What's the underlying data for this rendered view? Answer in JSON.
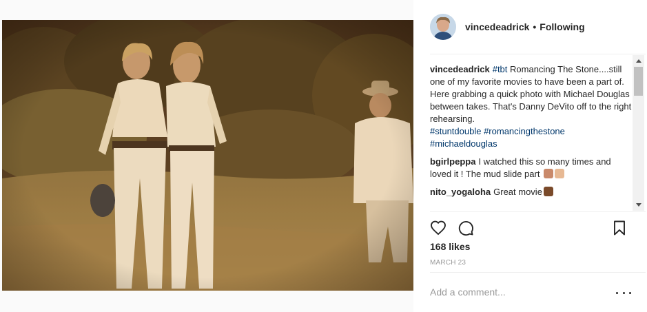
{
  "post": {
    "photo_alt": "",
    "header": {
      "username": "vincedeadrick",
      "separator": "•",
      "following_label": "Following"
    },
    "caption": {
      "username": "vincedeadrick",
      "hashtag_tbt": "#tbt",
      "text": " Romancing The Stone....still one of my favorite movies to have been a part of. Here grabbing a quick photo with Michael Douglas between takes. That's Danny DeVito off to the right rehearsing.",
      "hashtags": [
        "#stuntdouble",
        "#romancingthestone",
        "#michaeldouglas"
      ]
    },
    "comments": [
      {
        "username": "bgirlpeppa",
        "text": "I watched this so many times and loved it ! The mud slide part",
        "emojis": [
          "flexed-biceps",
          "thumbs-up"
        ]
      },
      {
        "username": "nito_yogaloha",
        "text": "Great movie",
        "emojis": [
          "flexed-biceps"
        ]
      }
    ],
    "likes": "168 likes",
    "date": "MARCH 23",
    "add_comment_placeholder": "Add a comment...",
    "icons": {
      "like": "heart-icon",
      "comment": "comment-icon",
      "save": "bookmark-icon",
      "more": "more-options-icon"
    },
    "colors": {
      "hashtag": "#00376b",
      "text": "#262626",
      "muted": "#999999"
    }
  }
}
